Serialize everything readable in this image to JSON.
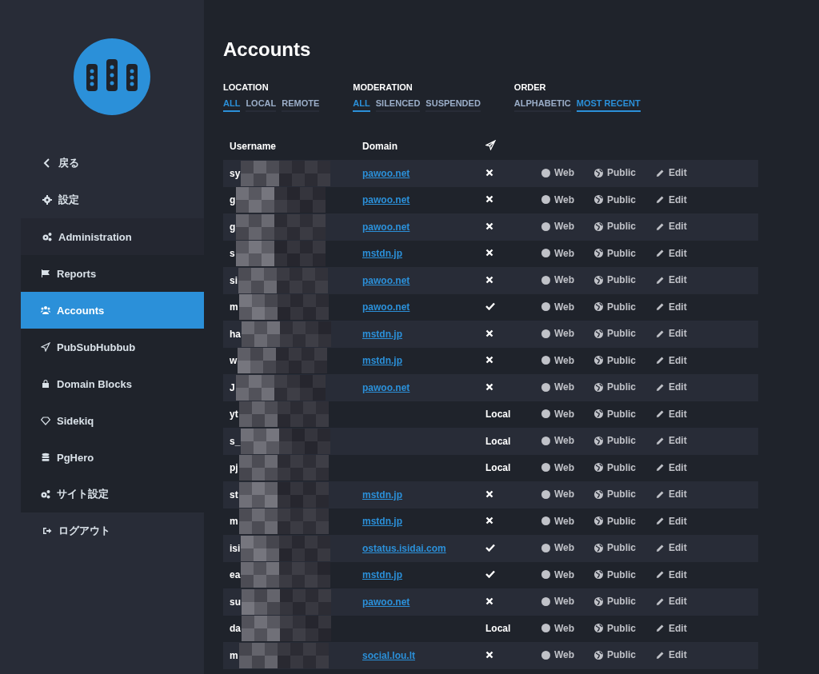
{
  "sidebar": {
    "items": [
      {
        "label": "戻る",
        "selected": false
      },
      {
        "label": "設定",
        "selected": false
      },
      {
        "label": "Administration",
        "selected": false
      },
      {
        "label": "Reports",
        "selected": false
      },
      {
        "label": "Accounts",
        "selected": true
      },
      {
        "label": "PubSubHubbub",
        "selected": false
      },
      {
        "label": "Domain Blocks",
        "selected": false
      },
      {
        "label": "Sidekiq",
        "selected": false
      },
      {
        "label": "PgHero",
        "selected": false
      },
      {
        "label": "サイト設定",
        "selected": false
      },
      {
        "label": "ログアウト",
        "selected": false
      }
    ]
  },
  "title": "Accounts",
  "filters": [
    {
      "heading": "LOCATION",
      "options": [
        {
          "label": "ALL",
          "selected": true
        },
        {
          "label": "LOCAL",
          "selected": false
        },
        {
          "label": "REMOTE",
          "selected": false
        }
      ]
    },
    {
      "heading": "MODERATION",
      "options": [
        {
          "label": "ALL",
          "selected": true
        },
        {
          "label": "SILENCED",
          "selected": false
        },
        {
          "label": "SUSPENDED",
          "selected": false
        }
      ]
    },
    {
      "heading": "ORDER",
      "options": [
        {
          "label": "ALPHABETIC",
          "selected": false
        },
        {
          "label": "MOST RECENT",
          "selected": true
        }
      ]
    }
  ],
  "table": {
    "columns": [
      "Username",
      "Domain"
    ],
    "rows": [
      {
        "username": "sy",
        "domain": "pawoo.net",
        "subscribed": false,
        "web": "Web",
        "privacy": "Public",
        "edit": "Edit"
      },
      {
        "username": "g",
        "domain": "pawoo.net",
        "subscribed": false,
        "web": "Web",
        "privacy": "Public",
        "edit": "Edit"
      },
      {
        "username": "g",
        "domain": "pawoo.net",
        "subscribed": false,
        "web": "Web",
        "privacy": "Public",
        "edit": "Edit"
      },
      {
        "username": "s",
        "domain": "mstdn.jp",
        "subscribed": false,
        "web": "Web",
        "privacy": "Public",
        "edit": "Edit"
      },
      {
        "username": "si",
        "domain": "pawoo.net",
        "subscribed": false,
        "web": "Web",
        "privacy": "Public",
        "edit": "Edit"
      },
      {
        "username": "m",
        "domain": "pawoo.net",
        "subscribed": true,
        "web": "Web",
        "privacy": "Public",
        "edit": "Edit"
      },
      {
        "username": "ha",
        "domain": "mstdn.jp",
        "subscribed": false,
        "web": "Web",
        "privacy": "Public",
        "edit": "Edit"
      },
      {
        "username": "w",
        "domain": "mstdn.jp",
        "subscribed": false,
        "web": "Web",
        "privacy": "Public",
        "edit": "Edit"
      },
      {
        "username": "J",
        "domain": "pawoo.net",
        "subscribed": false,
        "web": "Web",
        "privacy": "Public",
        "edit": "Edit"
      },
      {
        "username": "yt",
        "local_label": "Local",
        "web": "Web",
        "privacy": "Public",
        "edit": "Edit"
      },
      {
        "username": "s_",
        "local_label": "Local",
        "web": "Web",
        "privacy": "Public",
        "edit": "Edit"
      },
      {
        "username": "pj",
        "local_label": "Local",
        "web": "Web",
        "privacy": "Public",
        "edit": "Edit"
      },
      {
        "username": "st",
        "domain": "mstdn.jp",
        "subscribed": false,
        "web": "Web",
        "privacy": "Public",
        "edit": "Edit"
      },
      {
        "username": "m",
        "domain": "mstdn.jp",
        "subscribed": false,
        "web": "Web",
        "privacy": "Public",
        "edit": "Edit"
      },
      {
        "username": "isi",
        "domain": "ostatus.isidai.com",
        "subscribed": true,
        "web": "Web",
        "privacy": "Public",
        "edit": "Edit"
      },
      {
        "username": "ea",
        "domain": "mstdn.jp",
        "subscribed": true,
        "web": "Web",
        "privacy": "Public",
        "edit": "Edit"
      },
      {
        "username": "su",
        "domain": "pawoo.net",
        "subscribed": false,
        "web": "Web",
        "privacy": "Public",
        "edit": "Edit"
      },
      {
        "username": "da",
        "local_label": "Local",
        "web": "Web",
        "privacy": "Public",
        "edit": "Edit"
      },
      {
        "username": "m",
        "domain": "social.lou.lt",
        "subscribed": false,
        "web": "Web",
        "privacy": "Public",
        "edit": "Edit"
      }
    ]
  }
}
